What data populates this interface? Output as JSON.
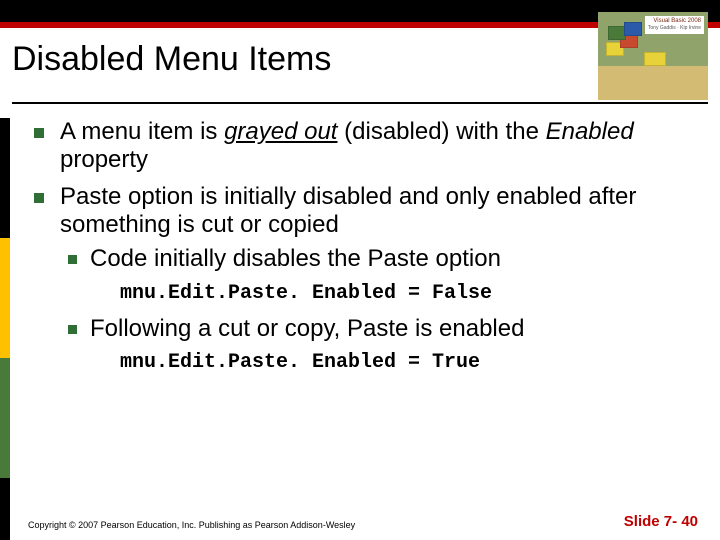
{
  "header": {
    "title": "Disabled Menu Items",
    "cover": {
      "brand": "Visual Basic",
      "year": "2008",
      "tagline": "Tony Gaddis · Kip Irvine"
    }
  },
  "bullets": {
    "b1_pre": "A menu item is ",
    "b1_italic_underline": "grayed out",
    "b1_mid": " (disabled) with the ",
    "b1_italic": "Enabled",
    "b1_post": " property",
    "b2": "Paste option is initially disabled and only enabled after something is cut or copied",
    "b2a": "Code initially disables the Paste option",
    "code1": "mnu.Edit.Paste. Enabled = False",
    "b2b": "Following a cut or copy, Paste is enabled",
    "code2": "mnu.Edit.Paste. Enabled = True"
  },
  "footer": {
    "copyright": "Copyright © 2007 Pearson Education, Inc. Publishing as Pearson Addison-Wesley",
    "slide": "Slide 7- 40"
  }
}
